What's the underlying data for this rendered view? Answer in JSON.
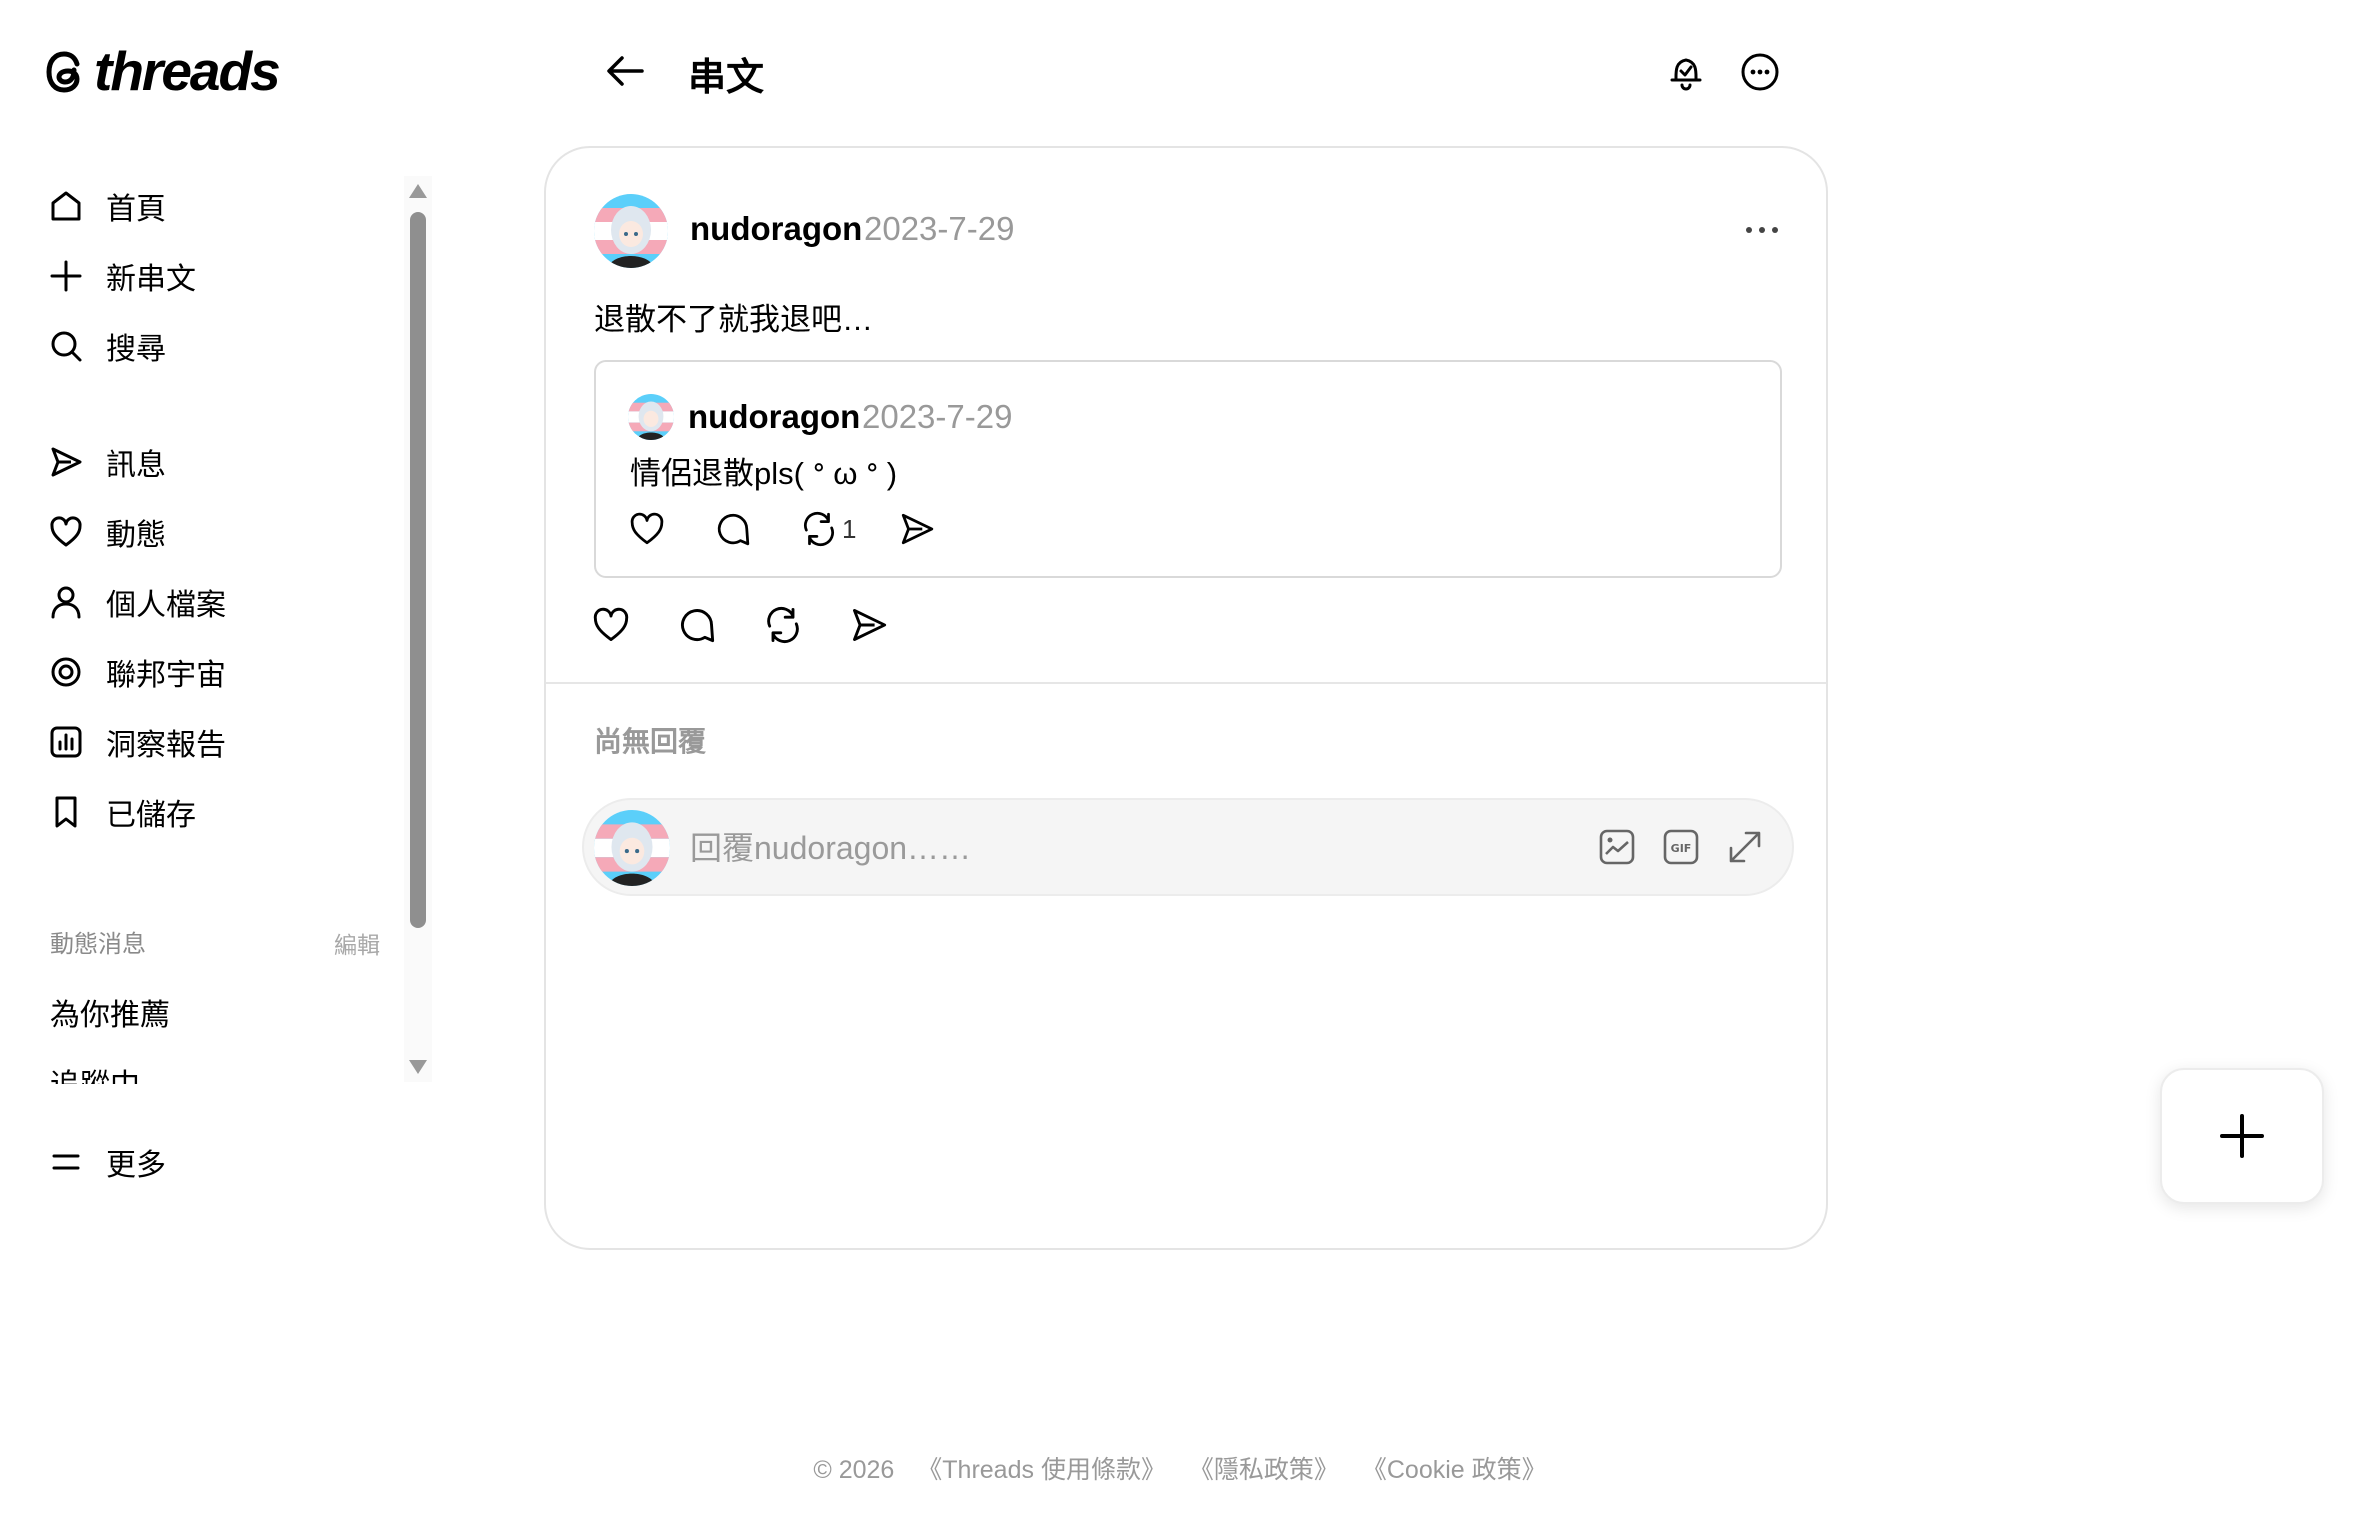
{
  "brand": {
    "name": "threads"
  },
  "header": {
    "title": "串文"
  },
  "nav": {
    "items": [
      {
        "label": "首頁",
        "icon": "home-icon"
      },
      {
        "label": "新串文",
        "icon": "plus-icon"
      },
      {
        "label": "搜尋",
        "icon": "search-icon"
      },
      {
        "label": "訊息",
        "icon": "send-icon"
      },
      {
        "label": "動態",
        "icon": "heart-icon"
      },
      {
        "label": "個人檔案",
        "icon": "person-icon"
      },
      {
        "label": "聯邦宇宙",
        "icon": "fediverse-icon"
      },
      {
        "label": "洞察報告",
        "icon": "chart-icon"
      },
      {
        "label": "已儲存",
        "icon": "bookmark-icon"
      }
    ],
    "more": "更多"
  },
  "feeds": {
    "heading": "動態消息",
    "edit": "編輯",
    "items": [
      "為你推薦",
      "追蹤中"
    ]
  },
  "post": {
    "username": "nudoragon",
    "date": "2023-7-29",
    "text": "退散不了就我退吧…",
    "quote": {
      "username": "nudoragon",
      "date": "2023-7-29",
      "text": "情侶退散pls( ᐤ ω ᐤ )",
      "repost_count": "1"
    }
  },
  "replies": {
    "empty_label": "尚無回覆",
    "placeholder": "回覆nudoragon……"
  },
  "footer": {
    "copyright": "© 2026",
    "links": [
      "《Threads 使用條款》",
      "《隱私政策》",
      "《Cookie 政策》"
    ]
  },
  "colors": {
    "muted": "#999999",
    "border": "#e4e4e4",
    "text": "#000000"
  }
}
